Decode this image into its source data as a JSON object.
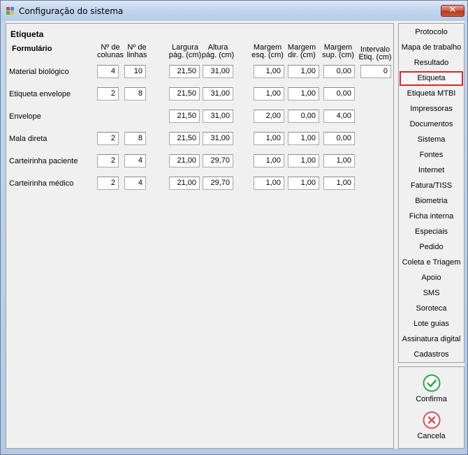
{
  "window": {
    "title": "Configuração do sistema",
    "close_glyph": "✕"
  },
  "panel": {
    "section_title": "Etiqueta",
    "headers": {
      "form": "Formulário",
      "cols_1": "Nº de",
      "cols_2": "colunas",
      "lines_1": "Nº de",
      "lines_2": "linhas",
      "width_1": "Largura",
      "width_2": "pág. (cm)",
      "height_1": "Altura",
      "height_2": "pág. (cm)",
      "mleft_1": "Margem",
      "mleft_2": "esq. (cm)",
      "mright_1": "Margem",
      "mright_2": "dir. (cm)",
      "mtop_1": "Margem",
      "mtop_2": "sup. (cm)",
      "interval_1": "Intervalo",
      "interval_2": "Etiq. (cm)"
    },
    "rows": [
      {
        "label": "Material biológico",
        "cols": "4",
        "lines": "10",
        "width": "21,50",
        "height": "31,00",
        "mleft": "1,00",
        "mright": "1,00",
        "mtop": "0,00",
        "interval": "0"
      },
      {
        "label": "Etiqueta envelope",
        "cols": "2",
        "lines": "8",
        "width": "21,50",
        "height": "31,00",
        "mleft": "1,00",
        "mright": "1,00",
        "mtop": "0,00"
      },
      {
        "label": "Envelope",
        "width": "21,50",
        "height": "31,00",
        "mleft": "2,00",
        "mright": "0,00",
        "mtop": "4,00"
      },
      {
        "label": "Mala direta",
        "cols": "2",
        "lines": "8",
        "width": "21,50",
        "height": "31,00",
        "mleft": "1,00",
        "mright": "1,00",
        "mtop": "0,00"
      },
      {
        "label": "Carteirinha paciente",
        "cols": "2",
        "lines": "4",
        "width": "21,00",
        "height": "29,70",
        "mleft": "1,00",
        "mright": "1,00",
        "mtop": "1,00"
      },
      {
        "label": "Carteirinha médico",
        "cols": "2",
        "lines": "4",
        "width": "21,00",
        "height": "29,70",
        "mleft": "1,00",
        "mright": "1,00",
        "mtop": "1,00"
      }
    ]
  },
  "sidebar": {
    "items": [
      "Protocolo",
      "Mapa de trabalho",
      "Resultado",
      "Etiqueta",
      "Etiqueta MTBI",
      "Impressoras",
      "Documentos",
      "Sistema",
      "Fontes",
      "Internet",
      "Fatura/TISS",
      "Biometria",
      "Ficha interna",
      "Especiais",
      "Pedido",
      "Coleta e Triagem",
      "Apoio",
      "SMS",
      "Soroteca",
      "Lote guias",
      "Assinatura digital",
      "Cadastros"
    ],
    "active": "Etiqueta"
  },
  "actions": {
    "confirm_label": "Confirma",
    "cancel_label": "Cancela"
  },
  "colors": {
    "confirm": "#2ea84a",
    "cancel": "#d9534f",
    "active_border": "#d42a2a"
  }
}
